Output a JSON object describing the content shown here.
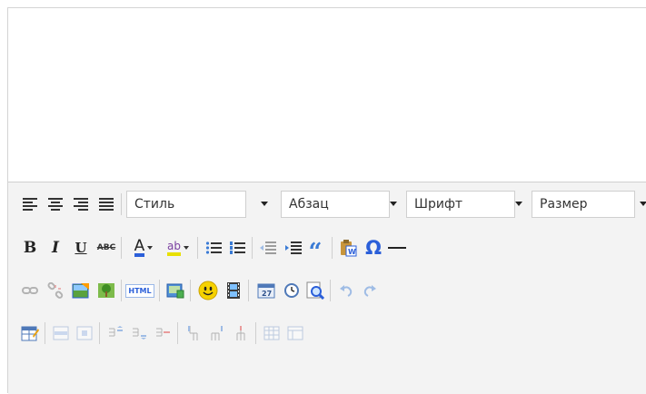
{
  "toolbar": {
    "styles_label": "Стиль",
    "format_label": "Абзац",
    "font_label": "Шрифт",
    "size_label": "Размер",
    "bold_glyph": "B",
    "italic_glyph": "I",
    "underline_glyph": "U",
    "strike_glyph": "ABC",
    "text_color_glyph": "A",
    "highlight_glyph": "ab",
    "html_glyph": "HTML",
    "special_char_glyph": "Ω",
    "blockquote_glyph": "“"
  },
  "colors": {
    "toolbar_bg": "#f3f3f3",
    "border": "#cfcfcf",
    "text_color_accent": "#2b5fd9",
    "highlight_accent": "#e8e000",
    "smiley_yellow": "#f6d200",
    "icon_blue": "#3a7bd5"
  }
}
